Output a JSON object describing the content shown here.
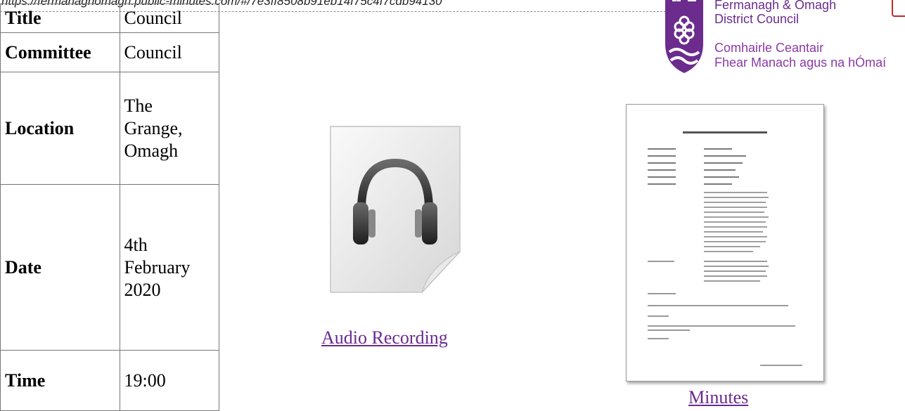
{
  "banner": {
    "url_text": "https://fermanaghomagh.public-minutes.com/#/7e3ff8508b91eb14f75c4f7cdb94130"
  },
  "meeting": {
    "rows": [
      {
        "label": "Title",
        "value": "Council"
      },
      {
        "label": "Committee",
        "value": "Council"
      },
      {
        "label": "Location",
        "value_lines": [
          "The",
          "Grange,",
          "Omagh"
        ]
      },
      {
        "label": "Date",
        "value_lines": [
          "4th",
          "February",
          "2020"
        ]
      },
      {
        "label": "Time",
        "value": "19:00"
      }
    ]
  },
  "logo": {
    "line1": "Fermanagh & Omagh",
    "line2": "District Council",
    "line3": "Comhairle Ceantair",
    "line4": "Fhear Manach agus na hÓmaí",
    "brand_color": "#6b2c8e"
  },
  "media": {
    "audio": {
      "link_text": "Audio Recording ",
      "icon": "headphones-audio-file-icon"
    },
    "minutes": {
      "link_text": "Minutes",
      "icon": "document-thumbnail"
    }
  },
  "colors": {
    "link": "#6a2a8f",
    "border": "#777777"
  }
}
